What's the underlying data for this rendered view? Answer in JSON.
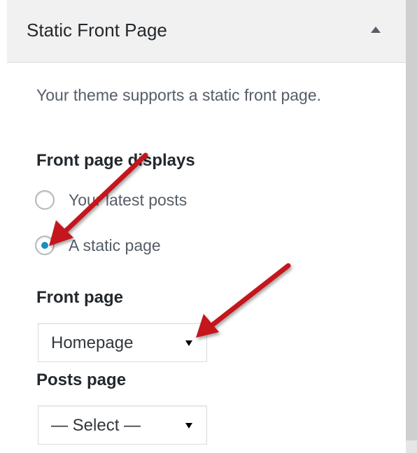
{
  "section": {
    "title": "Static Front Page",
    "collapse_icon": "triangle-up-icon"
  },
  "description": "Your theme supports a static front page.",
  "front_page_displays": {
    "label": "Front page displays",
    "options": [
      {
        "label": "Your latest posts",
        "checked": false
      },
      {
        "label": "A static page",
        "checked": true
      }
    ]
  },
  "front_page": {
    "label": "Front page",
    "selected": "Homepage"
  },
  "posts_page": {
    "label": "Posts page",
    "selected": "— Select —"
  },
  "colors": {
    "radio_checked": "#1e8cbe",
    "annotation_arrow": "#c4161c",
    "header_bg": "#f1f1f1"
  }
}
